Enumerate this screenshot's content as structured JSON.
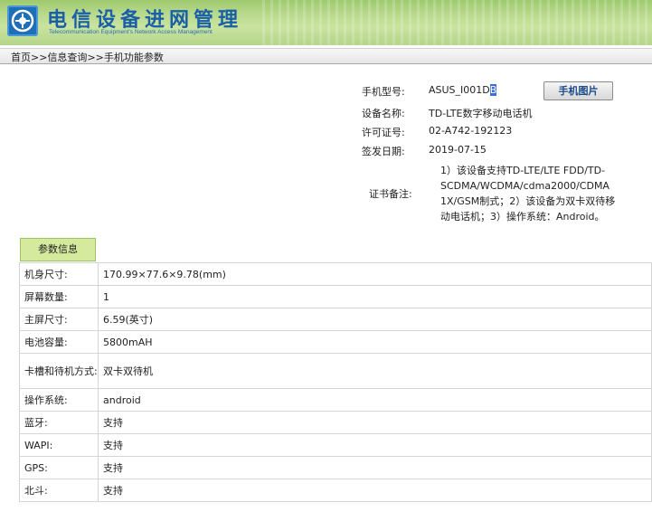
{
  "header": {
    "title": "电信设备进网管理",
    "subtitle": "Telecommunication Equipment's Network Access Management"
  },
  "breadcrumb": {
    "home": "首页",
    "sep": ">>",
    "query": "信息查询",
    "current": "手机功能参数"
  },
  "device": {
    "model_label": "手机型号:",
    "model_value_main": "ASUS_I001D",
    "model_value_sel": "B",
    "photo_button": "手机图片",
    "name_label": "设备名称:",
    "name_value": "TD-LTE数字移动电话机",
    "license_label": "许可证号:",
    "license_value": "02-A742-192123",
    "date_label": "签发日期:",
    "date_value": "2019-07-15",
    "remark_label": "证书备注:",
    "remark_value": "1）该设备支持TD-LTE/LTE FDD/TD-SCDMA/WCDMA/cdma2000/CDMA 1X/GSM制式；2）该设备为双卡双待移动电话机；3）操作系统：Android。"
  },
  "params": {
    "tab_label": "参数信息",
    "rows": [
      {
        "key": "机身尺寸:",
        "value": "170.99×77.6×9.78(mm)"
      },
      {
        "key": "屏幕数量:",
        "value": "1"
      },
      {
        "key": "主屏尺寸:",
        "value": "6.59(英寸)"
      },
      {
        "key": "电池容量:",
        "value": "5800mAH"
      },
      {
        "key": "卡槽和待机方式:",
        "value": "双卡双待机"
      },
      {
        "key": "操作系统:",
        "value": "android"
      },
      {
        "key": "蓝牙:",
        "value": "支持"
      },
      {
        "key": "WAPI:",
        "value": "支持"
      },
      {
        "key": "GPS:",
        "value": "支持"
      },
      {
        "key": "北斗:",
        "value": "支持"
      }
    ]
  }
}
